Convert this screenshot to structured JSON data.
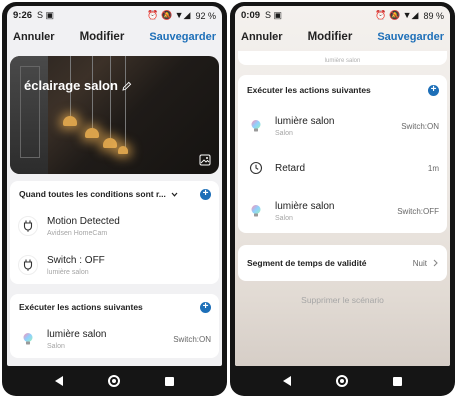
{
  "screen1": {
    "status": {
      "time": "9:26",
      "left_icons": "S ▣",
      "right_icons": "⏰ 🔕 ▼◢",
      "battery": "92 %"
    },
    "appbar": {
      "cancel": "Annuler",
      "title": "Modifier",
      "save": "Sauvegarder"
    },
    "hero": {
      "title": "éclairage salon"
    },
    "conditions": {
      "header": "Quand toutes les conditions sont r...",
      "items": [
        {
          "title": "Motion Detected",
          "subtitle": "Avidsen HomeCam",
          "icon": "plug-icon"
        },
        {
          "title": "Switch : OFF",
          "subtitle": "lumière salon",
          "icon": "plug-icon"
        }
      ]
    },
    "actions": {
      "header": "Exécuter les actions suivantes",
      "items": [
        {
          "title": "lumière salon",
          "subtitle": "Salon",
          "value": "Switch:ON",
          "icon": "bulb-icon"
        }
      ]
    }
  },
  "screen2": {
    "status": {
      "time": "0:09",
      "left_icons": "S ▣",
      "right_icons": "⏰ 🔕 ▼◢",
      "battery": "89 %"
    },
    "appbar": {
      "cancel": "Annuler",
      "title": "Modifier",
      "save": "Sauvegarder"
    },
    "partial_label": "lumière salon",
    "actions": {
      "header": "Exécuter les actions suivantes",
      "items": [
        {
          "title": "lumière salon",
          "subtitle": "Salon",
          "value": "Switch:ON",
          "icon": "bulb-icon"
        },
        {
          "title": "Retard",
          "subtitle": "",
          "value": "1m",
          "icon": "timer-icon"
        },
        {
          "title": "lumière salon",
          "subtitle": "Salon",
          "value": "Switch:OFF",
          "icon": "bulb-icon"
        }
      ]
    },
    "validity": {
      "label": "Segment de temps de validité",
      "value": "Nuit"
    },
    "delete_label": "Supprimer le scénario"
  },
  "colors": {
    "accent": "#1d6fb8"
  }
}
